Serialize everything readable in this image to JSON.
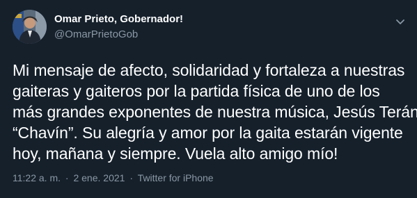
{
  "author": {
    "name": "Omar Prieto, Gobernador!",
    "handle": "@OmarPrietoGob"
  },
  "tweet": {
    "lines": [
      "Mi mensaje de afecto, solidaridad y fortaleza a nuestras",
      "gaiteras y gaiteros por la partida física de uno de los",
      "más grandes exponentes de nuestra música, Jesús Terán",
      "“Chavín”. Su alegría y amor por la gaita estarán vigente",
      "hoy, mañana y siempre. Vuela alto amigo mío!"
    ]
  },
  "meta": {
    "time": "11:22 a. m.",
    "separator": "·",
    "date": "2 ene. 2021",
    "source": "Twitter for iPhone"
  },
  "icons": {
    "more": "chevron-down-icon"
  },
  "colors": {
    "background": "#15202b",
    "primary_text": "#ffffff",
    "secondary_text": "#8b98a5"
  }
}
